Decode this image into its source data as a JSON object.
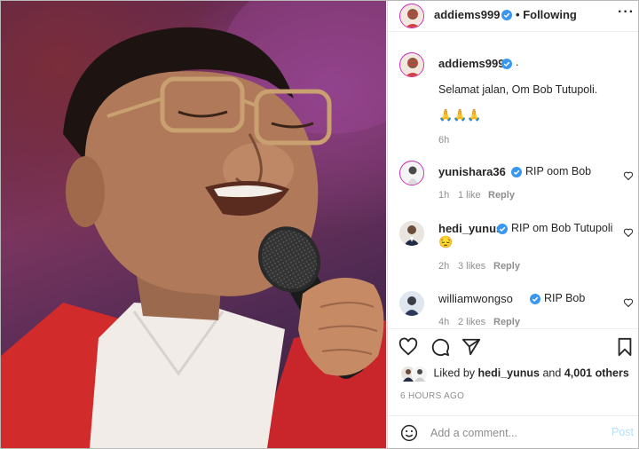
{
  "header": {
    "username": "addiems999",
    "separator": "•",
    "follow_status": "Following",
    "more_icon": "more-dots-icon"
  },
  "caption": {
    "username": "addiems999",
    "suffix": ".",
    "text": "Selamat jalan, Om Bob Tutupoli.",
    "emoji": "🙏🙏🙏",
    "time": "6h"
  },
  "comments": [
    {
      "username": "yunishara36",
      "text": "RIP oom Bob",
      "time": "1h",
      "likes": "1 like",
      "reply": "Reply"
    },
    {
      "username": "hedi_yunus",
      "text": "RIP om Bob Tutupoli",
      "text2": "😔",
      "time": "2h",
      "likes": "3 likes",
      "reply": "Reply"
    },
    {
      "username": "williamwongso",
      "text": "RIP Bob",
      "time": "4h",
      "likes": "2 likes",
      "reply": "Reply"
    }
  ],
  "actions": {
    "like_icon": "heart-icon",
    "comment_icon": "comment-icon",
    "share_icon": "share-icon",
    "save_icon": "bookmark-icon"
  },
  "likes": {
    "prefix": "Liked by",
    "user": "hedi_yunus",
    "middle": "and",
    "others": "4,001 others"
  },
  "timestamp": "6 HOURS AGO",
  "add_comment": {
    "placeholder": "Add a comment...",
    "post_label": "Post",
    "emoji_icon": "smiley-icon"
  },
  "colors": {
    "verified": "#3897f0",
    "post_button_disabled": "#b2dffc",
    "story_ring": "#c92bb7",
    "jacket": "#d12b2b"
  }
}
